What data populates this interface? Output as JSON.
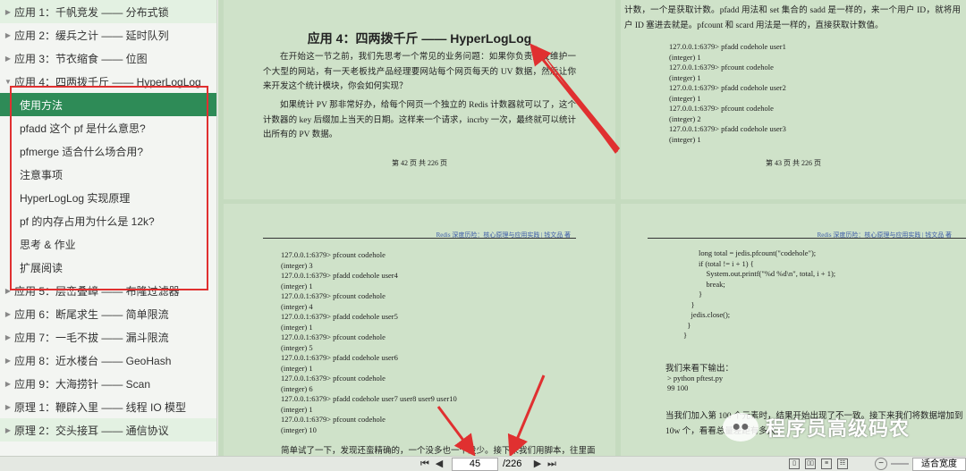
{
  "sidebar": {
    "items_before": [
      {
        "label": "应用 1：千帆竞发 —— 分布式锁",
        "highlight": true
      },
      {
        "label": "应用 2：缓兵之计 —— 延时队列",
        "highlight": false
      },
      {
        "label": "应用 3：节衣缩食 —— 位图",
        "highlight": false
      }
    ],
    "expanded": {
      "label": "应用 4：四两拨千斤 —— HyperLogLog"
    },
    "children": [
      {
        "label": "使用方法",
        "active": true
      },
      {
        "label": "pfadd 这个 pf 是什么意思?"
      },
      {
        "label": "pfmerge 适合什么场合用?"
      },
      {
        "label": "注意事项"
      },
      {
        "label": "HyperLogLog 实现原理"
      },
      {
        "label": "pf 的内存占用为什么是 12k?"
      },
      {
        "label": "思考 & 作业"
      },
      {
        "label": "扩展阅读"
      }
    ],
    "items_after": [
      {
        "label": "应用 5：层峦叠嶂 —— 布隆过滤器",
        "highlight": false
      },
      {
        "label": "应用 6：断尾求生 —— 简单限流",
        "highlight": false
      },
      {
        "label": "应用 7：一毛不拔 —— 漏斗限流",
        "highlight": false
      },
      {
        "label": "应用 8：近水楼台 —— GeoHash",
        "highlight": false
      },
      {
        "label": "应用 9：大海捞针 —— Scan",
        "highlight": false
      },
      {
        "label": "原理 1：鞭辟入里 —— 线程 IO 模型",
        "highlight": false
      },
      {
        "label": "原理 2：交头接耳 —— 通信协议",
        "highlight": true
      }
    ]
  },
  "pages": {
    "tl": {
      "title": "应用 4：四两拨千斤 —— HyperLogLog",
      "p1": "在开始这一节之前，我们先思考一个常见的业务问题：如果你负责开发维护一个大型的网站，有一天老板找产品经理要网站每个网页每天的 UV 数据，然后让你来开发这个统计模块，你会如何实现？",
      "p2": "如果统计 PV 那非常好办，给每个网页一个独立的 Redis 计数器就可以了，这个计数器的 key 后缀加上当天的日期。这样来一个请求，incrby 一次，最终就可以统计出所有的 PV 数据。",
      "footer": "第 42 页 共 226 页"
    },
    "tr": {
      "para": "计数，一个是获取计数。pfadd 用法和 set 集合的 sadd 是一样的，来一个用户 ID，就将用户 ID 塞进去就是。pfcount 和 scard 用法是一样的，直接获取计数值。",
      "code": "127.0.0.1:6379> pfadd codehole user1\n(integer) 1\n127.0.0.1:6379> pfcount codehole\n(integer) 1\n127.0.0.1:6379> pfadd codehole user2\n(integer) 1\n127.0.0.1:6379> pfcount codehole\n(integer) 2\n127.0.0.1:6379> pfadd codehole user3\n(integer) 1",
      "footer": "第 43 页 共 226 页"
    },
    "bl": {
      "header": "Redis 深度历险：核心原理与应用实践  |  钱文品 著",
      "code": "127.0.0.1:6379> pfcount codehole\n(integer) 3\n127.0.0.1:6379> pfadd codehole user4\n(integer) 1\n127.0.0.1:6379> pfcount codehole\n(integer) 4\n127.0.0.1:6379> pfadd codehole user5\n(integer) 1\n127.0.0.1:6379> pfcount codehole\n(integer) 5\n127.0.0.1:6379> pfadd codehole user6\n(integer) 1\n127.0.0.1:6379> pfcount codehole\n(integer) 6\n127.0.0.1:6379> pfadd codehole user7 user8 user9 user10\n(integer) 1\n127.0.0.1:6379> pfcount codehole\n(integer) 10",
      "last_line": "简单试了一下，发现还蛮精确的，一个没多也一个没少。接下来我们用脚本，往里面"
    },
    "br": {
      "header": "Redis 深度历险：核心原理与应用实践  |  钱文品 著",
      "code": "        long total = jedis.pfcount(\"codehole\");\n        if (total != i + 1) {\n            System.out.printf(\"%d %d\\n\", total, i + 1);\n            break;\n        }\n    }\n    jedis.close();\n  }\n}",
      "out_title": "我们来看下输出：",
      "out": "> python pftest.py\n99 100",
      "p2": "当我们加入第 100 个元素时，结果开始出现了不一致。接下来我们将数据增加到 10w 个，看看总量差距有多大。"
    }
  },
  "watermark": {
    "text": "程序员高级码农",
    "icon": "wechat-icon"
  },
  "toolbar": {
    "current_page": "45",
    "total_pages": "/226",
    "zoom_label": "适合宽度"
  },
  "colors": {
    "accent": "#2e8b57",
    "annotation": "#e03030",
    "page_bg": "#cfe2c9"
  }
}
